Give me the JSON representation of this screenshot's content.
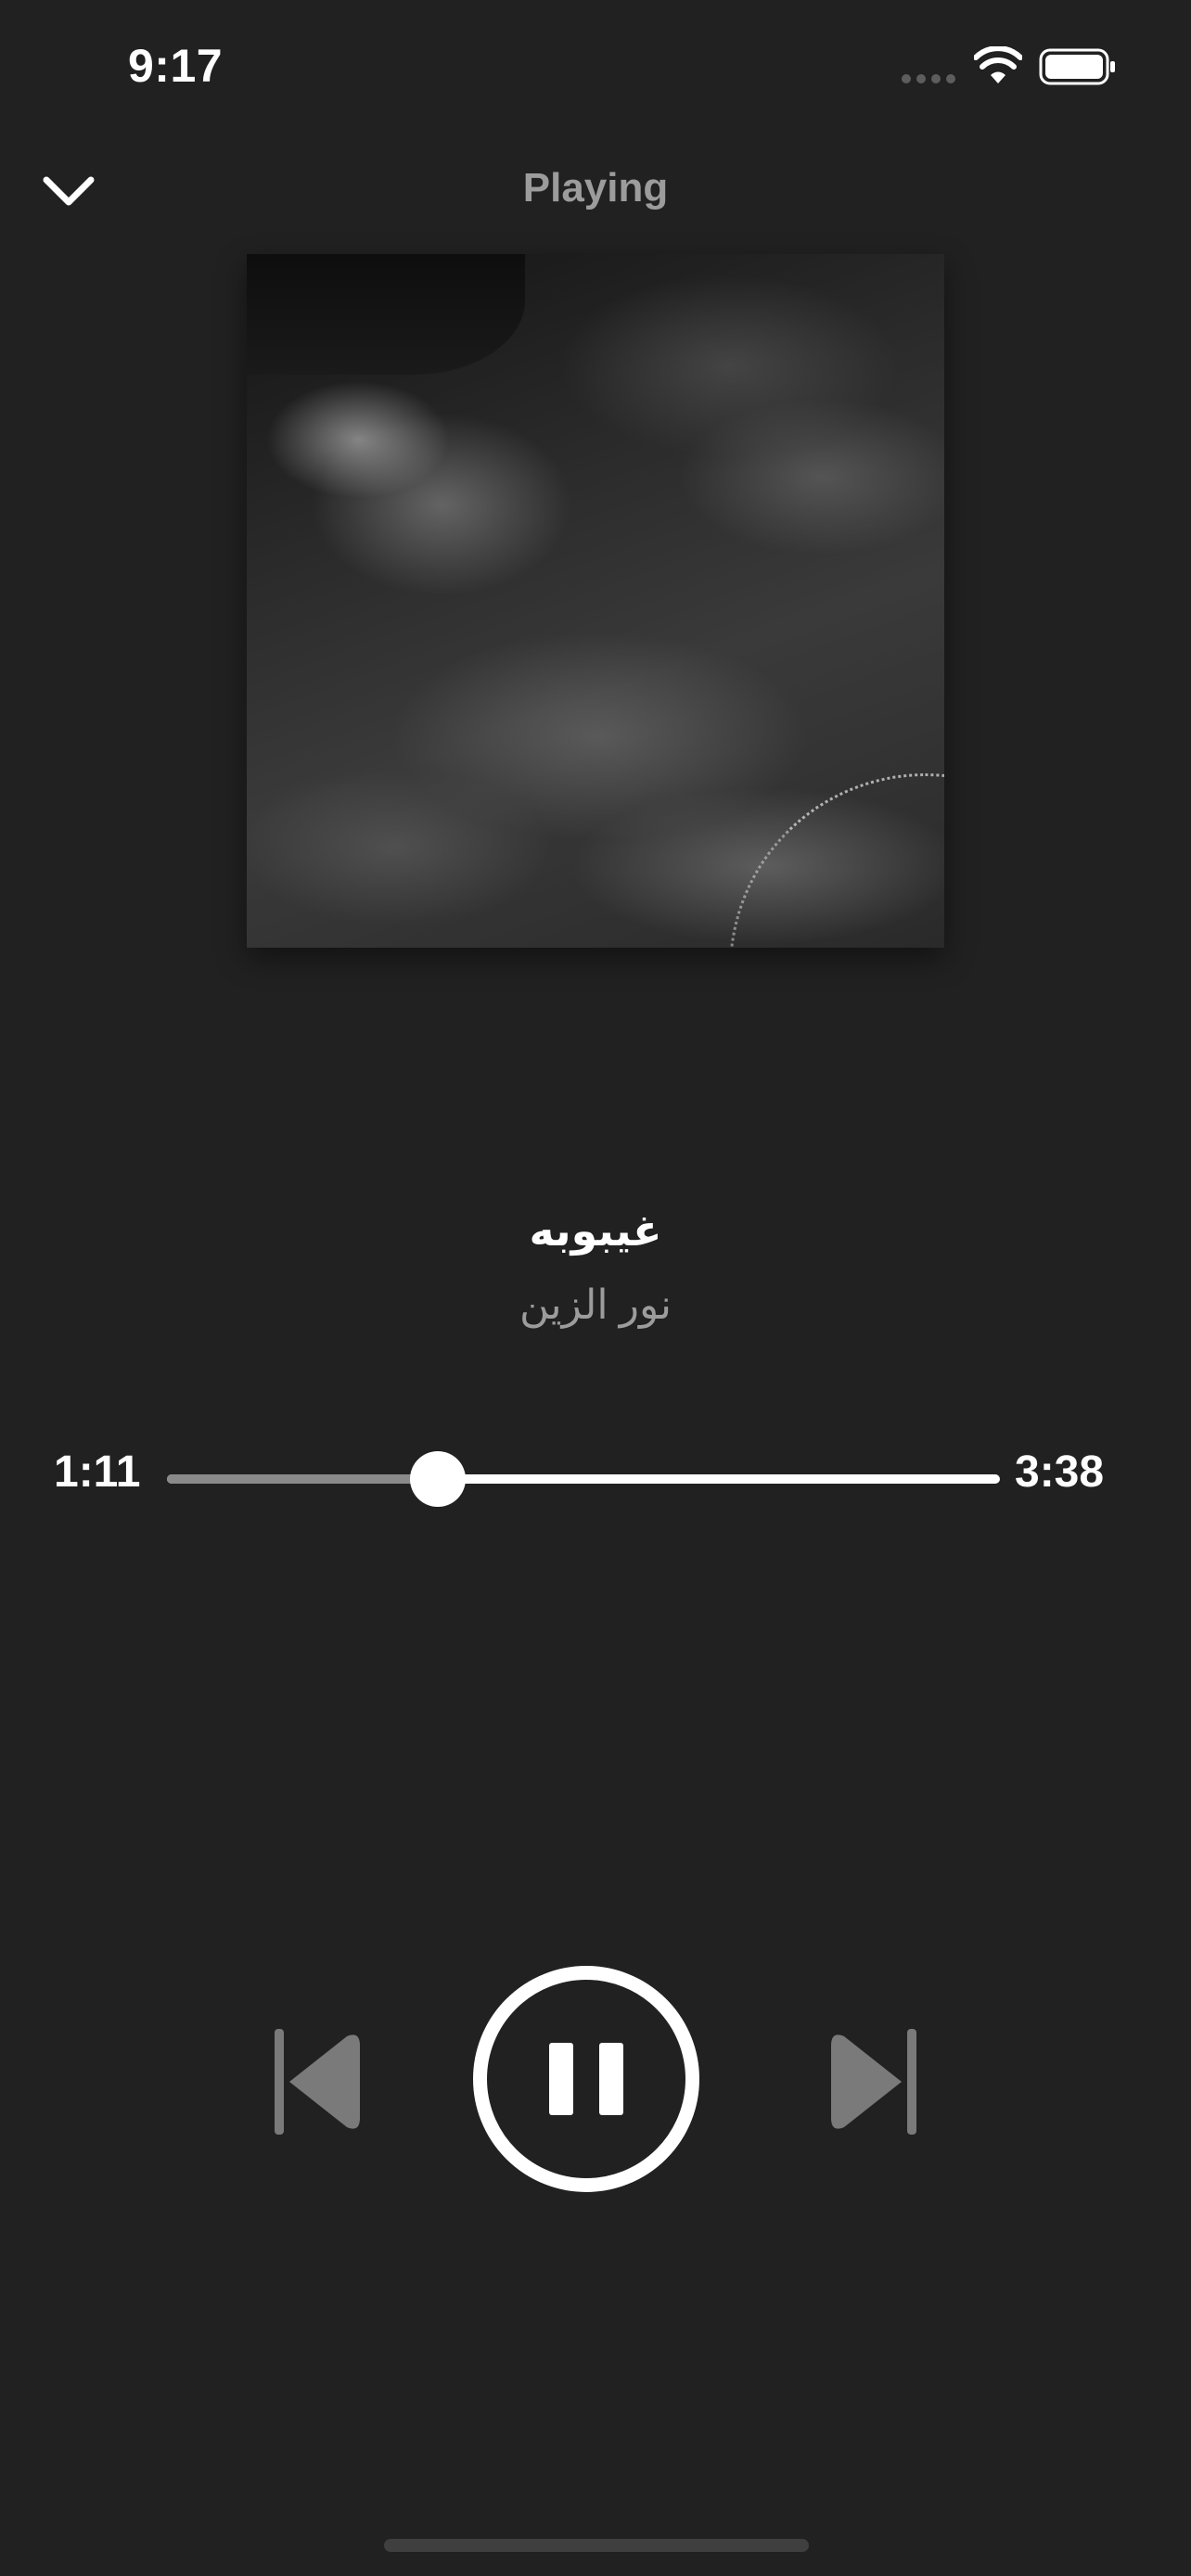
{
  "status_bar": {
    "time": "9:17"
  },
  "header": {
    "title": "Playing",
    "collapse_icon": "chevron-down-icon"
  },
  "track": {
    "title": "غيبوبه",
    "artist": "نور الزين"
  },
  "progress": {
    "elapsed": "1:11",
    "total": "3:38",
    "fraction": 0.3257
  },
  "controls": {
    "previous_icon": "skip-previous-icon",
    "play_pause_icon": "pause-icon",
    "next_icon": "skip-next-icon"
  },
  "colors": {
    "background": "#212121",
    "primary": "#ffffff",
    "secondary": "#9c9c9c",
    "disabled_control": "#7a7a7a",
    "progress_played": "#8a8a8a"
  }
}
